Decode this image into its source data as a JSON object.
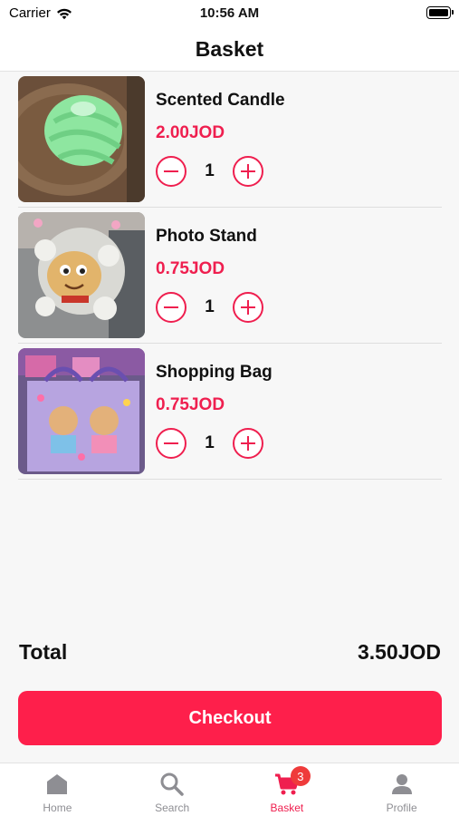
{
  "status_bar": {
    "carrier": "Carrier",
    "time": "10:56 AM"
  },
  "header": {
    "title": "Basket"
  },
  "items": [
    {
      "name": "Scented Candle",
      "price": "2.00JOD",
      "quantity": "1",
      "image": "green-candle-photo"
    },
    {
      "name": "Photo Stand",
      "price": "0.75JOD",
      "quantity": "1",
      "image": "cartoon-sheep-photo-stand"
    },
    {
      "name": "Shopping Bag",
      "price": "0.75JOD",
      "quantity": "1",
      "image": "purple-bear-shopping-bag"
    }
  ],
  "summary": {
    "total_label": "Total",
    "total_value": "3.50JOD"
  },
  "checkout": {
    "label": "Checkout"
  },
  "tabbar": {
    "home": "Home",
    "search": "Search",
    "basket": "Basket",
    "profile": "Profile",
    "basket_badge": "3"
  },
  "colors": {
    "accent": "#ef1f4f",
    "button": "#fe1f4b",
    "badge": "#ef3b3b",
    "inactive_tab": "#8e8e93"
  }
}
